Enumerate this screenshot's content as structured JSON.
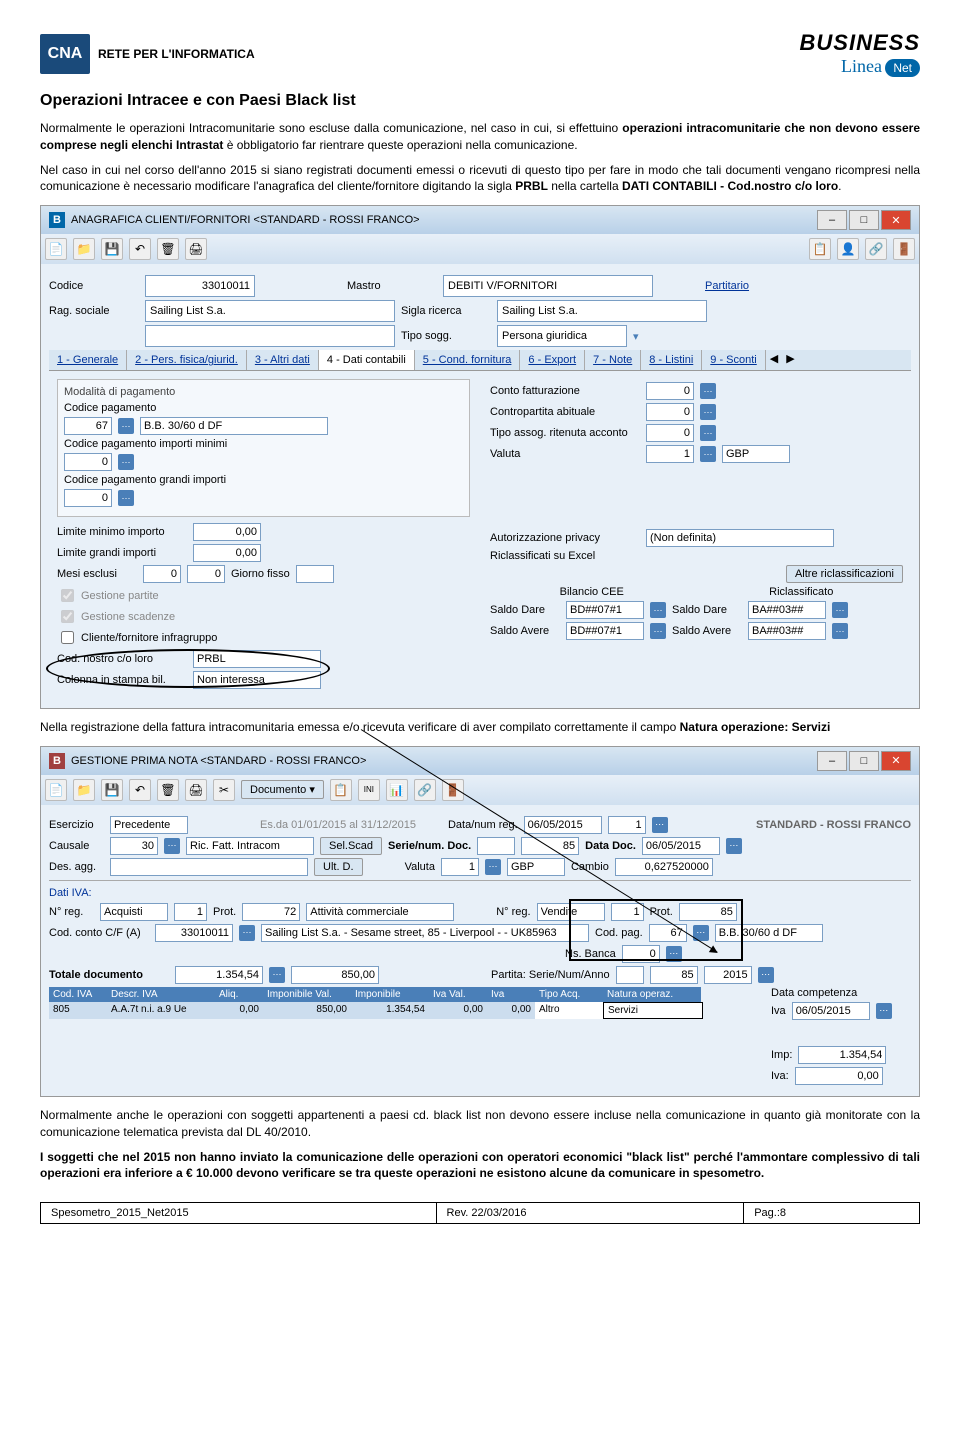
{
  "header": {
    "cna": "CNA",
    "subtitle": "RETE PER L'INFORMATICA",
    "biz": "BUSINESS",
    "linea": "Linea",
    "net": "Net"
  },
  "title": "Operazioni Intracee e con Paesi Black list",
  "p1": "Normalmente le operazioni Intracomunitarie sono escluse dalla comunicazione, nel caso in cui, si effettuino ",
  "p1b": "operazioni intracomunitarie che non devono essere comprese negli elenchi Intrastat",
  "p1c": " è obbligatorio far rientrare queste operazioni nella comunicazione.",
  "p2": "Nel caso in cui nel corso dell'anno 2015 si siano registrati documenti emessi o ricevuti di questo tipo per fare in modo che tali documenti vengano ricompresi nella comunicazione è necessario modificare l'anagrafica del cliente/fornitore digitando la sigla ",
  "p2b": "PRBL",
  "p2c": " nella cartella ",
  "p2d": "DATI CONTABILI - Cod.nostro c/o loro",
  "p2e": ".",
  "win1": {
    "title": "ANAGRAFICA CLIENTI/FORNITORI <STANDARD - ROSSI FRANCO>",
    "codice_lbl": "Codice",
    "codice": "33010011",
    "mastro_lbl": "Mastro",
    "mastro": "DEBITI V/FORNITORI",
    "part": "Partitario",
    "rag_lbl": "Rag. sociale",
    "rag": "Sailing List S.a.",
    "sigla_lbl": "Sigla ricerca",
    "sigla": "Sailing List S.a.",
    "tipo_lbl": "Tipo sogg.",
    "tipo": "Persona giuridica",
    "tabs": [
      "1 - Generale",
      "2 - Pers. fisica/giurid.",
      "3 - Altri dati",
      "4 - Dati contabili",
      "5 - Cond. fornitura",
      "6 - Export",
      "7 - Note",
      "8 - Listini",
      "9 - Sconti"
    ],
    "modpag": "Modalità di pagamento",
    "codpag_lbl": "Codice pagamento",
    "codpag": "67",
    "codpag_desc": "B.B. 30/60 d DF",
    "codmin_lbl": "Codice pagamento importi minimi",
    "codmin": "0",
    "codgr_lbl": "Codice pagamento grandi importi",
    "codgr": "0",
    "limmin_lbl": "Limite minimo importo",
    "limmin": "0,00",
    "limgr_lbl": "Limite grandi importi",
    "limgr": "0,00",
    "mesi_lbl": "Mesi esclusi",
    "mesi1": "0",
    "mesi2": "0",
    "gf_lbl": "Giorno fisso",
    "chk1": "Gestione partite",
    "chk2": "Gestione scadenze",
    "chk3": "Cliente/fornitore infragruppo",
    "cnl_lbl": "Cod. nostro c/o loro",
    "cnl": "PRBL",
    "col_lbl": "Colonna in stampa bil.",
    "col": "Non interessa",
    "cf_lbl": "Conto fatturazione",
    "cf": "0",
    "ca_lbl": "Contropartita abituale",
    "ca": "0",
    "tr_lbl": "Tipo assog. ritenuta acconto",
    "tr": "0",
    "val_lbl": "Valuta",
    "val": "1",
    "val_desc": "GBP",
    "ap_lbl": "Autorizzazione privacy",
    "ap": "(Non definita)",
    "re_lbl": "Riclassificati su Excel",
    "ar": "Altre riclassificazioni",
    "bc": "Bilancio CEE",
    "ric": "Riclassificato",
    "sd_lbl": "Saldo Dare",
    "sd1": "BD##07#1",
    "sd2": "BA##03##",
    "sa_lbl": "Saldo Avere",
    "sa1": "BD##07#1",
    "sa2": "BA##03##"
  },
  "p3a": "Nella registrazione della fattura intracomunitaria emessa e/o ricevuta verificare di aver compilato correttamente il campo ",
  "p3b": "Natura operazione: Servizi",
  "win2": {
    "title": "GESTIONE PRIMA NOTA <STANDARD - ROSSI FRANCO>",
    "doc": "Documento",
    "es_lbl": "Esercizio",
    "es": "Precedente",
    "es_desc": "Es.da 01/01/2015 al 31/12/2015",
    "dnr_lbl": "Data/num reg.",
    "dnr": "06/05/2015",
    "dnr_n": "1",
    "std": "STANDARD - ROSSI FRANCO",
    "cau_lbl": "Causale",
    "cau": "30",
    "cau_desc": "Ric. Fatt. Intracom",
    "ss": "Sel.Scad",
    "snd_lbl": "Serie/num. Doc.",
    "snd": "85",
    "dd_lbl": "Data Doc.",
    "dd": "06/05/2015",
    "da_lbl": "Des. agg.",
    "ud": "Ult. D.",
    "v_lbl": "Valuta",
    "v": "1",
    "v_desc": "GBP",
    "cb_lbl": "Cambio",
    "cb": "0,627520000",
    "diva": "Dati IVA:",
    "nr_lbl": "N° reg.",
    "nr_a": "Acquisti",
    "nr_an": "1",
    "pr_lbl": "Prot.",
    "pr": "72",
    "ac": "Attività commerciale",
    "nr_v": "Vendite",
    "nr_vn": "1",
    "pr2": "85",
    "cc_lbl": "Cod. conto C/F (A)",
    "cc": "33010011",
    "cc_desc": "Sailing List S.a. - Sesame street, 85 - Liverpool - - UK85963",
    "cp_lbl": "Cod. pag.",
    "cp": "67",
    "cp_desc": "B.B. 30/60 d DF",
    "nb_lbl": "Ns. Banca",
    "nb": "0",
    "td_lbl": "Totale documento",
    "td1": "1.354,54",
    "td2": "850,00",
    "psa_lbl": "Partita: Serie/Num/Anno",
    "psa1": "85",
    "psa2": "2015",
    "dc_lbl": "Data competenza",
    "dc": "06/05/2015",
    "iva_lbl": "Iva",
    "thdrs": [
      "Cod. IVA",
      "Descr. IVA",
      "Aliq.",
      "Imponibile Val.",
      "Imponibile",
      "Iva Val.",
      "Iva",
      "Tipo Acq.",
      "Natura operaz."
    ],
    "trow": [
      "805",
      "A.A.7t n.i. a.9 Ue",
      "0,00",
      "850,00",
      "1.354,54",
      "0,00",
      "0,00",
      "Altro",
      "Servizi"
    ],
    "imp_lbl": "Imp:",
    "imp": "1.354,54",
    "iva2_lbl": "Iva:",
    "iva2": "0,00"
  },
  "p4": "Normalmente anche le operazioni con soggetti appartenenti a paesi cd. black list non devono essere incluse nella comunicazione in quanto già monitorate con la comunicazione telematica prevista dal DL 40/2010.",
  "p5": "I soggetti che nel 2015 non hanno inviato la comunicazione delle operazioni con operatori economici \"black list\" perché l'ammontare complessivo di tali operazioni era inferiore a € 10.000 devono verificare se tra queste operazioni ne esistono alcune da comunicare in spesometro.",
  "footer": {
    "c1": "Spesometro_2015_Net2015",
    "c2": "Rev. 22/03/2016",
    "c3": "Pag.:8"
  }
}
